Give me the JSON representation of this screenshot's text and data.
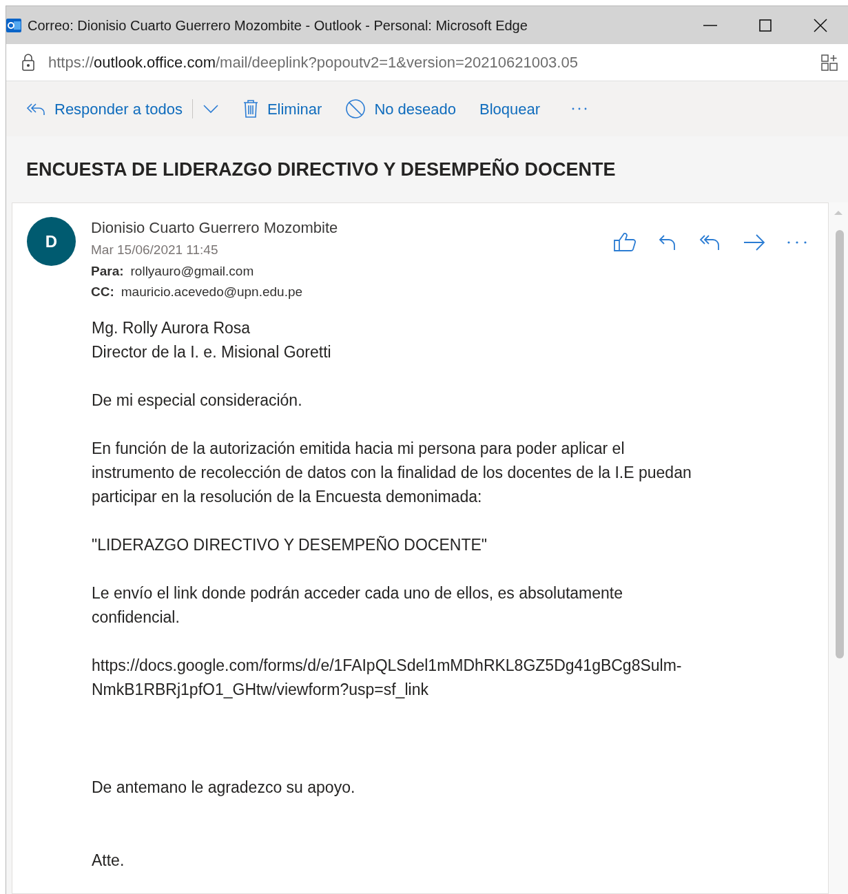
{
  "window": {
    "title": "Correo: Dionisio Cuarto Guerrero Mozombite - Outlook - Personal: Microsoft Edge"
  },
  "address_bar": {
    "scheme": "https://",
    "host": "outlook.office.com",
    "path": "/mail/deeplink?popoutv2=1&version=20210621003.05"
  },
  "toolbar": [
    {
      "kind": "reply_all",
      "label": "Responder a todos"
    },
    {
      "kind": "trash",
      "label": "Eliminar"
    },
    {
      "kind": "junk",
      "label": "No deseado"
    },
    {
      "kind": "plain",
      "label": "Bloquear"
    }
  ],
  "subject": "ENCUESTA DE LIDERAZGO DIRECTIVO Y DESEMPEÑO DOCENTE",
  "message": {
    "avatar": "D",
    "sender": "Dionisio Cuarto Guerrero Mozombite",
    "date": "Mar 15/06/2021 11:45",
    "recipients": [
      {
        "label": "Para:",
        "value": "rollyauro@gmail.com"
      },
      {
        "label": "CC:",
        "value": "mauricio.acevedo@upn.edu.pe"
      }
    ],
    "body": [
      [
        "Mg. Rolly Aurora Rosa",
        "Director de la I. e. Misional Goretti"
      ],
      [
        "De mi especial consideración."
      ],
      [
        "En función de la autorización emitida hacia mi persona para poder aplicar el",
        "instrumento de recolección de datos con la finalidad de los docentes de la I.E puedan",
        "participar en la resolución de la Encuesta demonimada:"
      ],
      [
        "\"LIDERAZGO DIRECTIVO Y DESEMPEÑO DOCENTE\""
      ],
      [
        "Le envío el link donde podrán acceder cada uno de ellos, es absolutamente",
        "confidencial."
      ],
      [
        "https://docs.google.com/forms/d/e/1FAIpQLSdel1mMDhRKL8GZ5Dg41gBCg8Sulm-",
        "NmkB1RBRj1pfO1_GHtw/viewform?usp=sf_link"
      ],
      [
        "De antemano le agradezco su apoyo."
      ],
      [
        "Atte."
      ]
    ]
  }
}
